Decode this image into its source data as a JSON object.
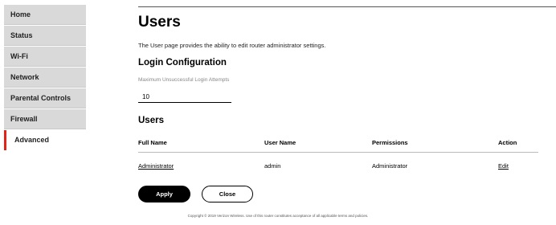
{
  "sidebar": {
    "items": [
      {
        "label": "Home"
      },
      {
        "label": "Status"
      },
      {
        "label": "Wi-Fi"
      },
      {
        "label": "Network"
      },
      {
        "label": "Parental Controls"
      },
      {
        "label": "Firewall"
      },
      {
        "label": "Advanced",
        "active": true
      }
    ]
  },
  "main": {
    "title": "Users",
    "description": "The User page provides the ability to edit router administrator settings.",
    "login_config": {
      "heading": "Login Configuration",
      "field_label": "Maximum Unsuccessful Login Attempts",
      "field_value": "10"
    },
    "users": {
      "heading": "Users",
      "columns": [
        "Full Name",
        "User Name",
        "Permissions",
        "Action"
      ],
      "rows": [
        {
          "full_name": "Administrator",
          "user_name": "admin",
          "permissions": "Administrator",
          "action": "Edit"
        }
      ]
    },
    "buttons": {
      "apply": "Apply",
      "close": "Close"
    }
  },
  "footer": {
    "text": "Copyright © 2019 Verizon Wireless. Use of this router constitutes acceptance of all applicable terms and policies."
  },
  "colors": {
    "accent": "#e2231a",
    "sidebar_bg": "#d9d9d9"
  }
}
